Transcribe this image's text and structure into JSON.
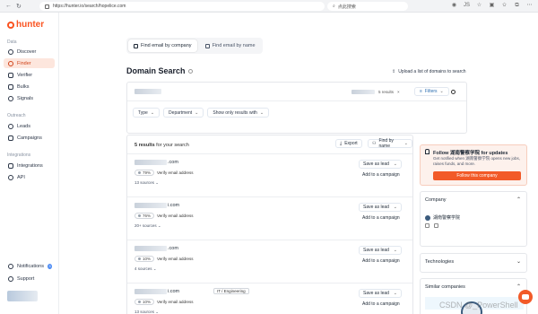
{
  "browser": {
    "url": "https://hunter.io/search/hopelice.com",
    "search_placeholder": "点此搜索",
    "profile_badge": "JS"
  },
  "app": {
    "name": "hunter",
    "brand_color": "#fa5320"
  },
  "sidebar": {
    "sections": [
      {
        "label": "Data",
        "items": [
          {
            "label": "Discover",
            "icon": "compass-icon"
          },
          {
            "label": "Finder",
            "icon": "search-icon",
            "active": true
          },
          {
            "label": "Verifier",
            "icon": "check-shield-icon"
          },
          {
            "label": "Bulks",
            "icon": "layers-icon"
          },
          {
            "label": "Signals",
            "icon": "signal-icon"
          }
        ]
      },
      {
        "label": "Outreach",
        "items": [
          {
            "label": "Leads",
            "icon": "users-icon"
          },
          {
            "label": "Campaigns",
            "icon": "send-icon"
          }
        ]
      },
      {
        "label": "Integrations",
        "items": [
          {
            "label": "Integrations",
            "icon": "plug-icon"
          },
          {
            "label": "API",
            "icon": "code-icon"
          }
        ]
      }
    ],
    "notifications_label": "Notifications",
    "notifications_count": "3",
    "support_label": "Support"
  },
  "tabs": [
    {
      "label": "Find email by company",
      "active": true
    },
    {
      "label": "Find email by name",
      "active": false
    }
  ],
  "page_title": "Domain Search",
  "upload_label": "Upload a list of domains to search",
  "search": {
    "results_label": "5 results",
    "filters_label": "Filters",
    "filter_dropdowns": [
      "Type",
      "Department",
      "Show only results with"
    ]
  },
  "results": {
    "count_label": "5 results",
    "suffix": "for your search",
    "export_label": "Export",
    "findby_label": "Find by name",
    "rows": [
      {
        "domain_suffix": ".com",
        "confidence": "79%",
        "verify": "Verify email address",
        "sources": "13 sources",
        "tag": "",
        "save": "Save as lead",
        "campaign": "Add to a campaign"
      },
      {
        "domain_suffix": "i.com",
        "confidence": "76%",
        "verify": "Verify email address",
        "sources": "20+ sources",
        "tag": "",
        "save": "Save as lead",
        "campaign": "Add to a campaign"
      },
      {
        "domain_suffix": ".com",
        "confidence": "10%",
        "verify": "Verify email address",
        "sources": "4 sources",
        "tag": "",
        "save": "Save as lead",
        "campaign": "Add to a campaign"
      },
      {
        "domain_suffix": "i.com",
        "confidence": "10%",
        "verify": "Verify email address",
        "sources": "13 sources",
        "tag": "IT / Engineering",
        "save": "Save as lead",
        "campaign": "Add to a campaign"
      }
    ]
  },
  "follow_card": {
    "title": "Follow 湖南警察学院 for updates",
    "description": "Get notified when 湖南警察学院 opens new jobs, raises funds, and more.",
    "button": "Follow this company"
  },
  "company_card": {
    "title": "Company",
    "name": "湖南警察学院"
  },
  "technologies_card": {
    "title": "Technologies"
  },
  "similar_card": {
    "title": "Similar companies"
  },
  "watermark": "CSDN @_PowerShell"
}
